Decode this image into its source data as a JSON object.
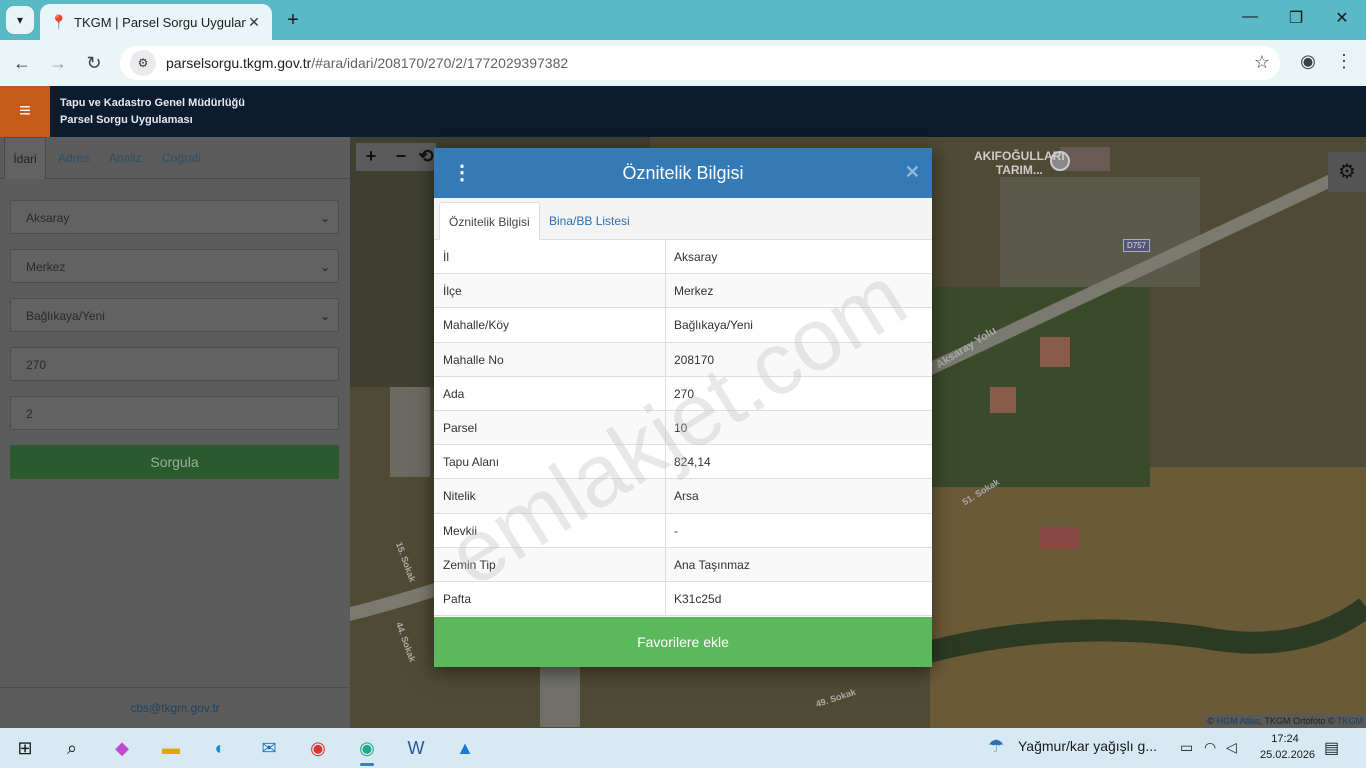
{
  "browser": {
    "tab_title": "TKGM | Parsel Sorgu Uygulamas",
    "url_host": "parselsorgu.tkgm.gov.tr",
    "url_path": "/#ara/idari/208170/270/2/1772029397382"
  },
  "app": {
    "title_line1": "Tapu ve Kadastro Genel Müdürlüğü",
    "title_line2": "Parsel Sorgu Uygulaması"
  },
  "sidebar": {
    "tabs": [
      "İdari",
      "Adres",
      "Analiz",
      "Coğrafi"
    ],
    "il": "Aksaray",
    "ilce": "Merkez",
    "mahalle": "Bağlıkaya/Yeni",
    "ada": "270",
    "parsel": "2",
    "query_button": "Sorgula",
    "footer_email": "cbs@tkgm.gov.tr"
  },
  "map": {
    "poi_line1": "AKIFOĞULLARI",
    "poi_line2": "TARIM...",
    "road_badge": "D757",
    "road1": "Aksaray Yolu",
    "road2": "51. Sokak",
    "road3": "49. Sokak",
    "road4": "15. Sokak",
    "road5": "44. Sokak",
    "attribution_prefix": "© ",
    "attribution_link1": "HGM Atlas",
    "attribution_mid": ", TKGM Ortofoto © ",
    "attribution_link2": "TKGM"
  },
  "modal": {
    "title": "Öznitelik Bilgisi",
    "tab_active": "Öznitelik Bilgisi",
    "tab_other": "Bina/BB Listesi",
    "rows": [
      {
        "key": "İl",
        "value": "Aksaray"
      },
      {
        "key": "İlçe",
        "value": "Merkez"
      },
      {
        "key": "Mahalle/Köy",
        "value": "Bağlıkaya/Yeni"
      },
      {
        "key": "Mahalle No",
        "value": "208170"
      },
      {
        "key": "Ada",
        "value": "270"
      },
      {
        "key": "Parsel",
        "value": "10"
      },
      {
        "key": "Tapu Alanı",
        "value": "824,14"
      },
      {
        "key": "Nitelik",
        "value": "Arsa"
      },
      {
        "key": "Mevkii",
        "value": "-"
      },
      {
        "key": "Zemin Tip",
        "value": "Ana Taşınmaz"
      },
      {
        "key": "Pafta",
        "value": "K31c25d"
      }
    ],
    "favorite_button": "Favorilere ekle"
  },
  "watermark": "emlakjet.com",
  "taskbar": {
    "weather_text": "Yağmur/kar yağışlı g...",
    "time": "17:24",
    "date": "25.02.2026"
  }
}
